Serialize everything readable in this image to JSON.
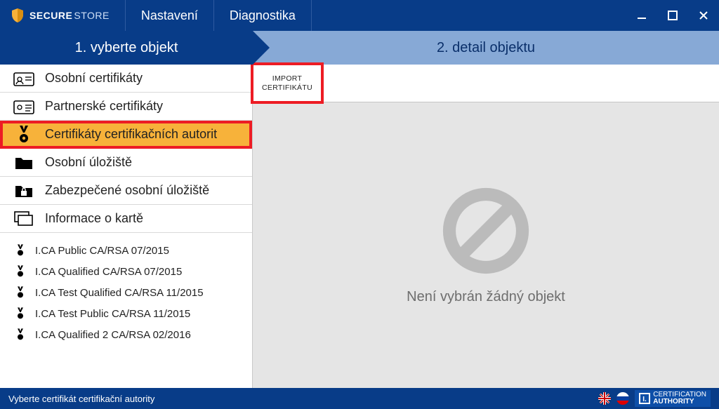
{
  "brand": {
    "strong": "SECURE",
    "light": "STORE"
  },
  "menu": {
    "items": [
      "Nastavení",
      "Diagnostika"
    ]
  },
  "tabs": {
    "left": "1. vyberte objekt",
    "right": "2. detail objektu"
  },
  "sidebar": {
    "items": [
      {
        "label": "Osobní certifikáty",
        "icon": "id-card-icon",
        "selected": false
      },
      {
        "label": "Partnerské certifikáty",
        "icon": "id-card-icon",
        "selected": false
      },
      {
        "label": "Certifikáty certifikačních autorit",
        "icon": "medal-icon",
        "selected": true
      },
      {
        "label": "Osobní úložiště",
        "icon": "folder-icon",
        "selected": false
      },
      {
        "label": "Zabezpečené osobní úložiště",
        "icon": "folder-lock-icon",
        "selected": false
      },
      {
        "label": "Informace o kartě",
        "icon": "windows-icon",
        "selected": false
      }
    ]
  },
  "certs": [
    "I.CA Public CA/RSA 07/2015",
    "I.CA Qualified CA/RSA 07/2015",
    "I.CA Test Qualified CA/RSA 11/2015",
    "I.CA Test Public CA/RSA 11/2015",
    "I.CA Qualified 2 CA/RSA 02/2016"
  ],
  "toolbar": {
    "import_l1": "IMPORT",
    "import_l2": "CERTIFIKÁTU"
  },
  "detail": {
    "empty": "Není vybrán žádný objekt"
  },
  "status": {
    "text": "Vyberte certifikát certifikační autority"
  },
  "authority": {
    "l1": "CERTIFICATION",
    "l2": "AUTHORITY"
  }
}
